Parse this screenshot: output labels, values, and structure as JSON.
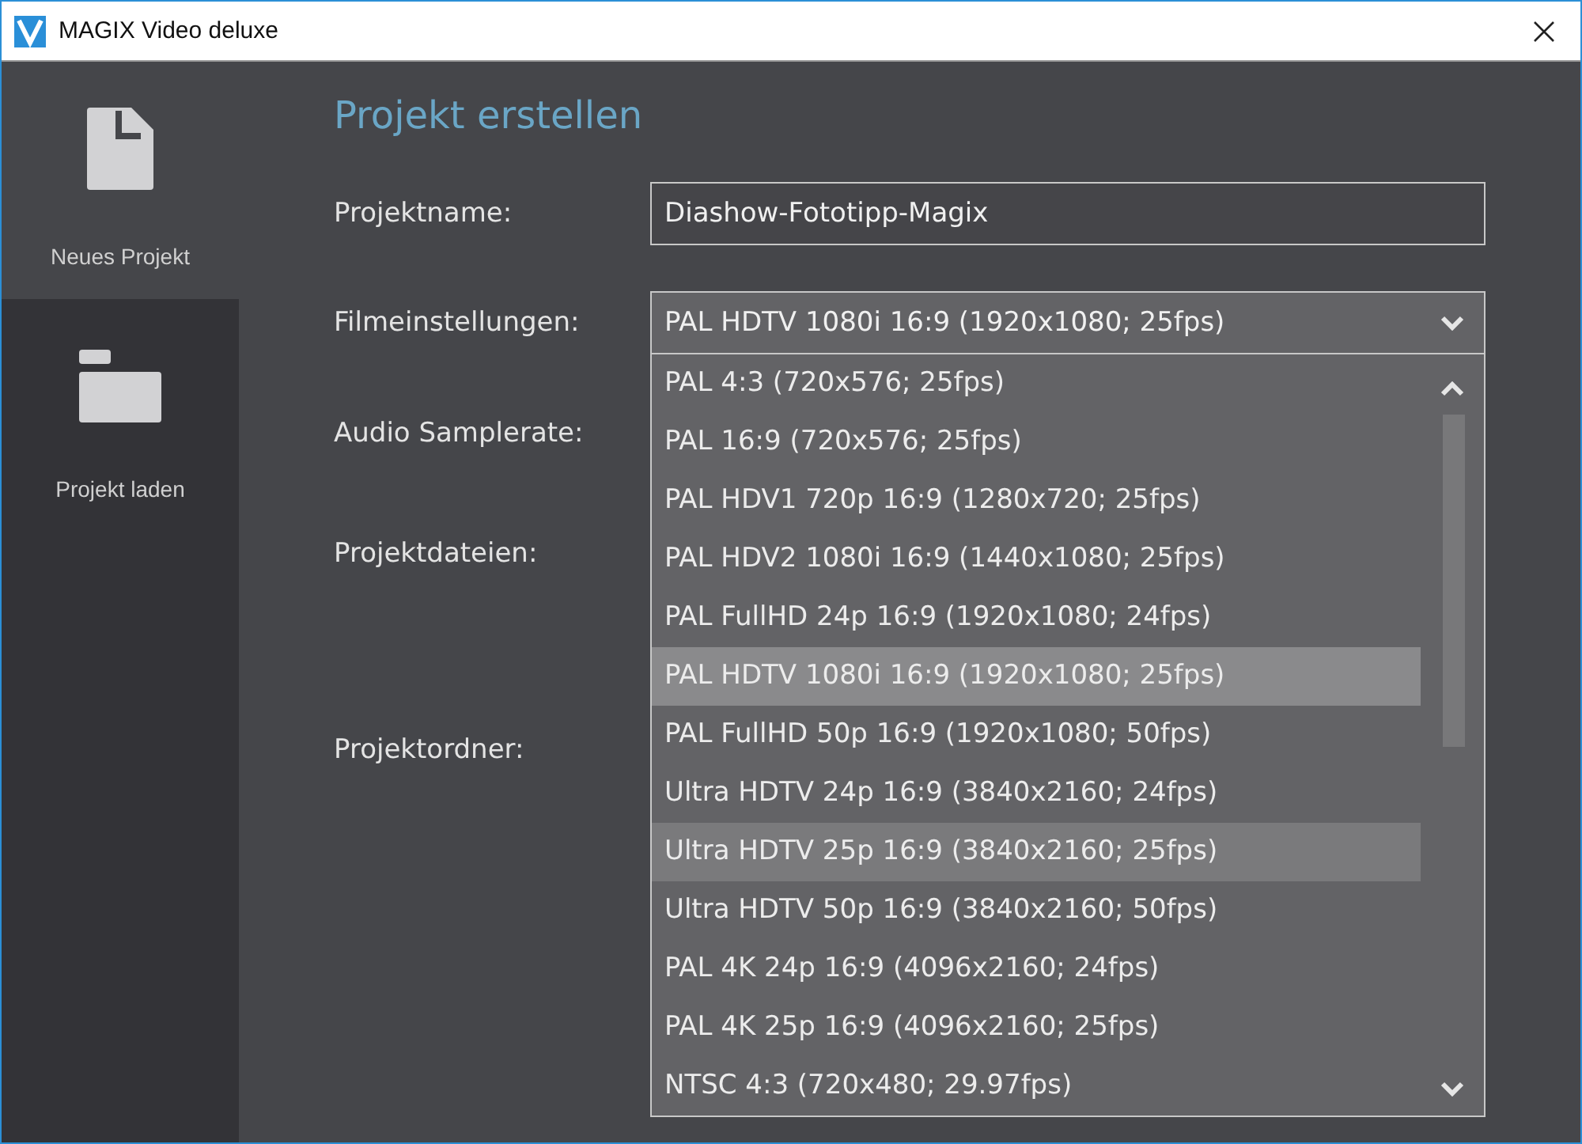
{
  "window": {
    "title": "MAGIX Video deluxe"
  },
  "sidebar": {
    "items": [
      {
        "label": "Neues Projekt",
        "kind": "file",
        "selected": true
      },
      {
        "label": "Projekt laden",
        "kind": "folder",
        "selected": false
      }
    ]
  },
  "heading": "Projekt erstellen",
  "fields": [
    {
      "label": "Projektname:",
      "kind": "text",
      "value": "Diashow-Fototipp-Magix"
    },
    {
      "label": "Filmeinstellungen:",
      "kind": "select",
      "value": "PAL HDTV 1080i 16:9 (1920x1080; 25fps)",
      "expanded": true,
      "options": [
        {
          "label": "PAL 4:3 (720x576; 25fps)",
          "selected": false,
          "hovered": false
        },
        {
          "label": "PAL 16:9 (720x576; 25fps)",
          "selected": false,
          "hovered": false
        },
        {
          "label": "PAL HDV1 720p 16:9 (1280x720; 25fps)",
          "selected": false,
          "hovered": false
        },
        {
          "label": "PAL HDV2 1080i 16:9 (1440x1080; 25fps)",
          "selected": false,
          "hovered": false
        },
        {
          "label": "PAL FullHD 24p 16:9 (1920x1080; 24fps)",
          "selected": false,
          "hovered": false
        },
        {
          "label": "PAL HDTV 1080i 16:9 (1920x1080; 25fps)",
          "selected": true,
          "hovered": false
        },
        {
          "label": "PAL FullHD 50p 16:9 (1920x1080; 50fps)",
          "selected": false,
          "hovered": false
        },
        {
          "label": "Ultra HDTV 24p 16:9 (3840x2160; 24fps)",
          "selected": false,
          "hovered": false
        },
        {
          "label": "Ultra HDTV 25p 16:9 (3840x2160; 25fps)",
          "selected": false,
          "hovered": true
        },
        {
          "label": "Ultra HDTV 50p 16:9 (3840x2160; 50fps)",
          "selected": false,
          "hovered": false
        },
        {
          "label": "PAL 4K 24p 16:9 (4096x2160; 24fps)",
          "selected": false,
          "hovered": false
        },
        {
          "label": "PAL 4K 25p 16:9 (4096x2160; 25fps)",
          "selected": false,
          "hovered": false
        },
        {
          "label": "NTSC 4:3 (720x480; 29.97fps)",
          "selected": false,
          "hovered": false
        }
      ]
    },
    {
      "label": "Audio Samplerate:",
      "kind": "label"
    },
    {
      "label": "Projektdateien:",
      "kind": "label"
    },
    {
      "label": "Projektordner:",
      "kind": "label"
    }
  ]
}
